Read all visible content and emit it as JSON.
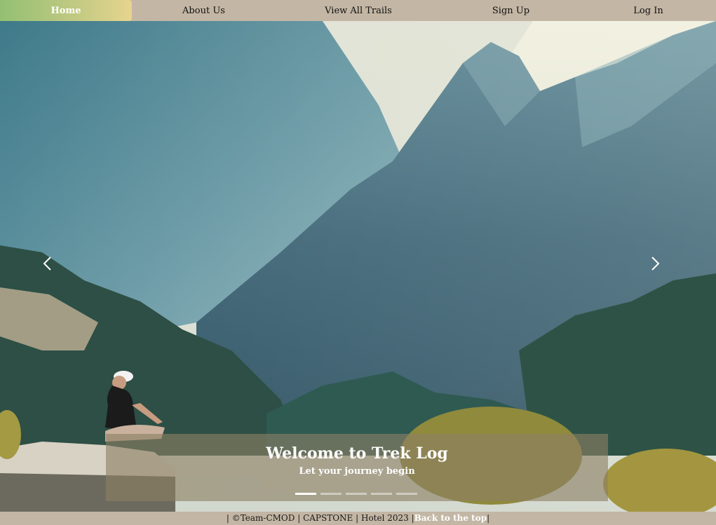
{
  "nav": {
    "home": "Home",
    "about": "About Us",
    "trails": "View All Trails",
    "signup": "Sign Up",
    "login": "Log In"
  },
  "carousel": {
    "title": "Welcome to Trek Log",
    "subtitle": "Let your journey begin",
    "slide_count": 5,
    "active_index": 0,
    "prev_icon": "chevron-left-icon",
    "next_icon": "chevron-right-icon"
  },
  "footer": {
    "text": "| ©Team-CMOD | CAPSTONE | Hotel 2023 |",
    "link": "Back to the top",
    "end": "|"
  },
  "colors": {
    "nav_bg": "#c3b6a4",
    "home_gradient_start": "#93c072",
    "home_gradient_end": "#e6d48e",
    "caption_bg": "#8c8064"
  }
}
